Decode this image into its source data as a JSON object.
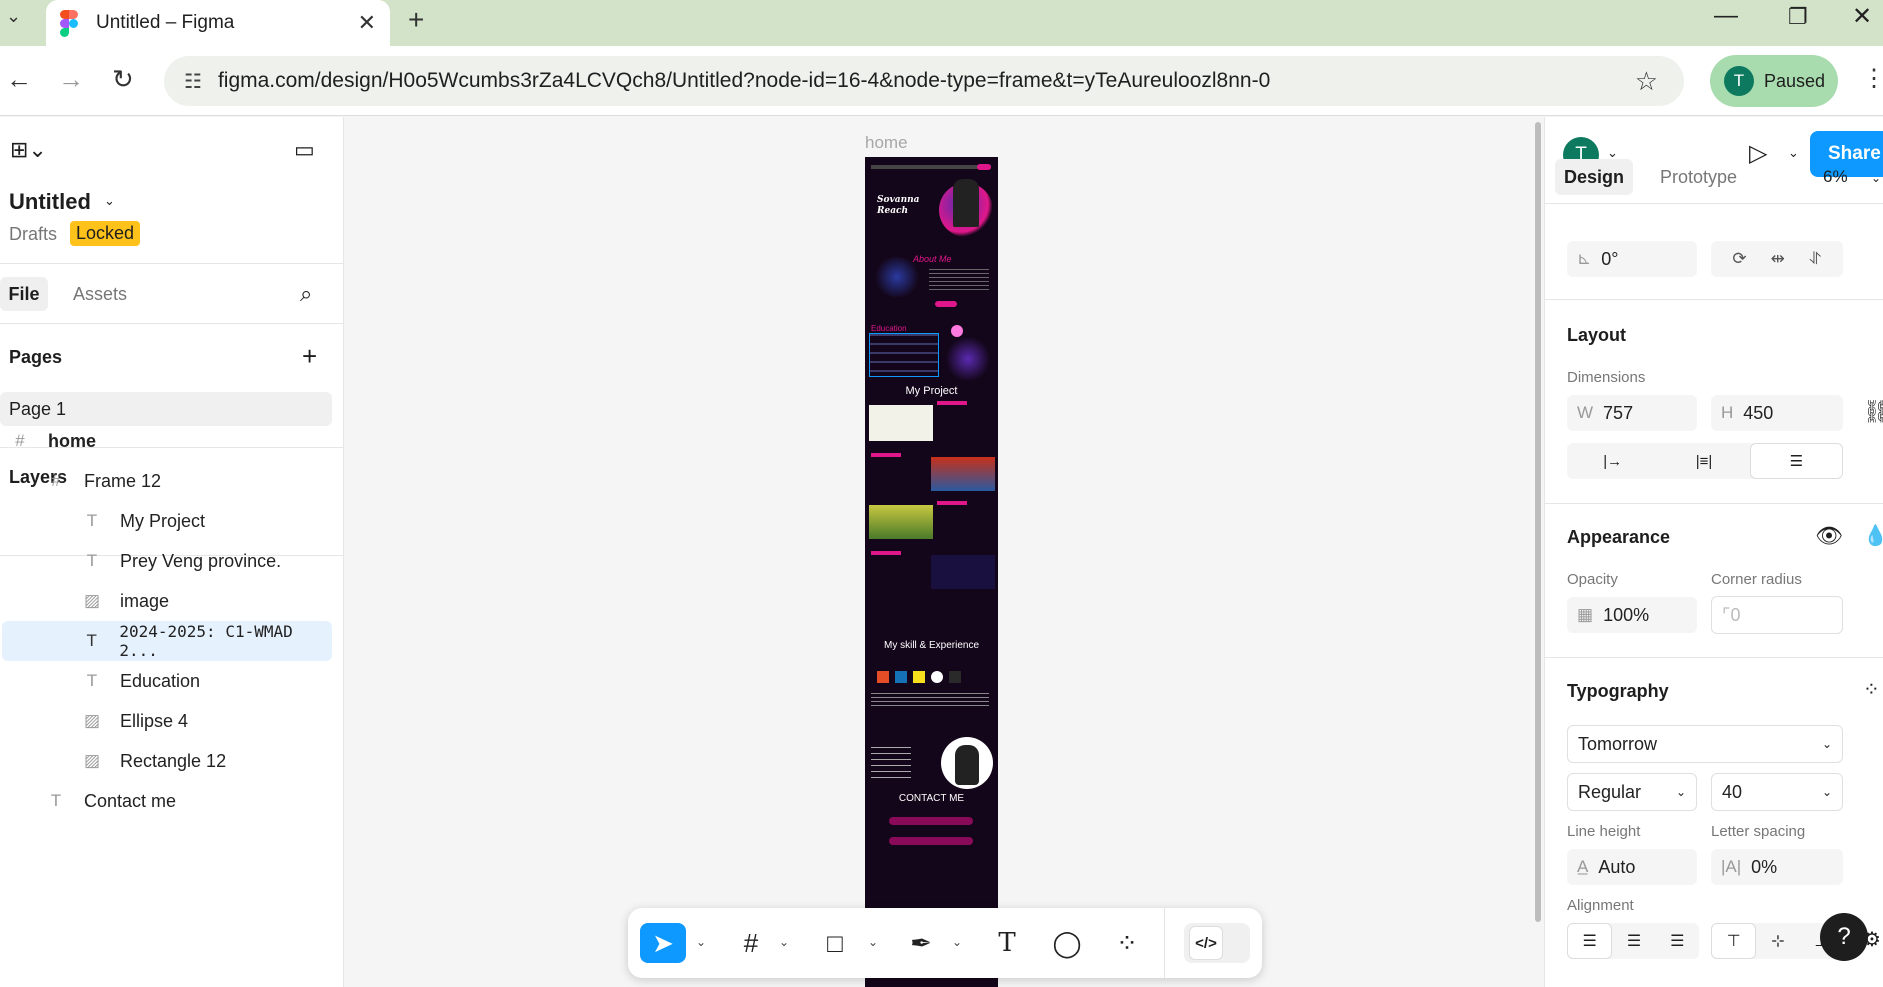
{
  "browser": {
    "tab_title": "Untitled – Figma",
    "new_tab": "+",
    "url": "figma.com/design/H0o5Wcumbs3rZa4LCVQch8/Untitled?node-id=16-4&node-type=frame&t=yTeAureuloozl8nn-0",
    "profile_initial": "T",
    "profile_status": "Paused"
  },
  "left_panel": {
    "file_name": "Untitled",
    "location": "Drafts",
    "badge": "Locked",
    "tabs": [
      "File",
      "Assets"
    ],
    "pages_heading": "Pages",
    "pages": [
      "Page 1"
    ],
    "layers_heading": "Layers",
    "layers": [
      {
        "name": "home",
        "icon": "frame-icon",
        "depth": 0
      },
      {
        "name": "Frame 12",
        "icon": "frame-icon",
        "depth": 1
      },
      {
        "name": "My Project",
        "icon": "text-icon",
        "depth": 2
      },
      {
        "name": "Prey Veng province.",
        "icon": "text-icon",
        "depth": 2
      },
      {
        "name": "image",
        "icon": "image-icon",
        "depth": 2
      },
      {
        "name": "2024-2025: C1-WMAD  2...",
        "icon": "text-icon",
        "depth": 2,
        "selected": true
      },
      {
        "name": "Education",
        "icon": "text-icon",
        "depth": 2
      },
      {
        "name": "Ellipse 4",
        "icon": "image-icon",
        "depth": 2
      },
      {
        "name": "Rectangle 12",
        "icon": "image-icon",
        "depth": 2
      },
      {
        "name": "Contact me",
        "icon": "text-icon",
        "depth": 1
      }
    ]
  },
  "canvas": {
    "frame_label": "home",
    "preview": {
      "hero_name": "Sovanna Reach",
      "about": "About Me",
      "education": "Education",
      "my_project": "My Project",
      "skills": "My skill & Experience",
      "contact": "CONTACT ME"
    }
  },
  "right_panel": {
    "tabs": [
      "Design",
      "Prototype"
    ],
    "zoom": "6%",
    "share": "Share",
    "avatar_initial": "T",
    "rotation": "0°",
    "layout_heading": "Layout",
    "dimensions_label": "Dimensions",
    "width_prefix": "W",
    "width": "757",
    "height_prefix": "H",
    "height": "450",
    "appearance_heading": "Appearance",
    "opacity_label": "Opacity",
    "opacity": "100%",
    "corner_label": "Corner radius",
    "corner": "0",
    "typography_heading": "Typography",
    "font_family": "Tomorrow",
    "font_weight": "Regular",
    "font_size": "40",
    "line_height_label": "Line height",
    "line_height": "Auto",
    "letter_spacing_label": "Letter spacing",
    "letter_spacing": "0%",
    "alignment_label": "Alignment"
  },
  "help": "?",
  "colors": {
    "figma_blue": "#0d99ff",
    "locked_badge": "#ffc21a",
    "frame_bg": "#14061a",
    "accent_pink": "#e0178a"
  }
}
